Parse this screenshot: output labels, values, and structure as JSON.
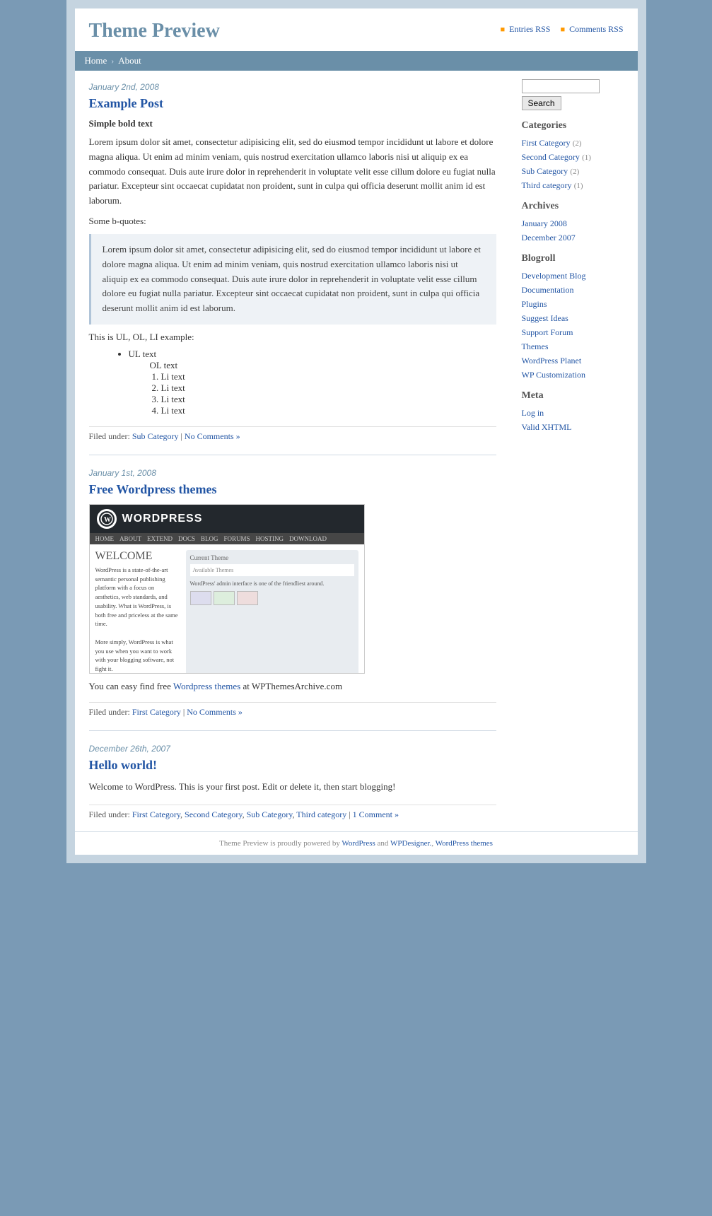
{
  "site": {
    "title": "Theme Preview",
    "rss_entries_label": "Entries RSS",
    "rss_comments_label": "Comments RSS"
  },
  "nav": {
    "home_label": "Home",
    "about_label": "About"
  },
  "posts": [
    {
      "date": "January 2nd, 2008",
      "title": "Example Post",
      "title_href": "#",
      "subtitle": "Simple bold text",
      "body1": "Lorem ipsum dolor sit amet, consectetur adipisicing elit, sed do eiusmod tempor incididunt ut labore et dolore magna aliqua. Ut enim ad minim veniam, quis nostrud exercitation ullamco laboris nisi ut aliquip ex ea commodo consequat. Duis aute irure dolor in reprehenderit in voluptate velit esse cillum dolore eu fugiat nulla pariatur. Excepteur sint occaecat cupidatat non proident, sunt in culpa qui officia deserunt mollit anim id est laborum.",
      "bquote_intro": "Some b-quotes:",
      "blockquote": "Lorem ipsum dolor sit amet, consectetur adipisicing elit, sed do eiusmod tempor incididunt ut labore et dolore magna aliqua. Ut enim ad minim veniam, quis nostrud exercitation ullamco laboris nisi ut aliquip ex ea commodo consequat. Duis aute irure dolor in reprehenderit in voluptate velit esse cillum dolore eu fugiat nulla pariatur. Excepteur sint occaecat cupidatat non proident, sunt in culpa qui officia deserunt mollit anim id est laborum.",
      "list_intro": "This is UL, OL, LI example:",
      "ul_label": "UL text",
      "ol_label": "OL text",
      "li_items": [
        "Li text",
        "Li text",
        "Li text",
        "Li text"
      ],
      "filed_under_label": "Filed under:",
      "filed_under_links": [
        {
          "text": "Sub Category",
          "href": "#"
        }
      ],
      "no_comments": "No Comments »",
      "no_comments_href": "#"
    },
    {
      "date": "January 1st, 2008",
      "title": "Free Wordpress themes",
      "title_href": "#",
      "free_text_before": "You can easy find free ",
      "free_text_link": "Wordpress themes",
      "free_text_link_href": "#",
      "free_text_after": " at WPThemesArchive.com",
      "filed_under_label": "Filed under:",
      "filed_under_links": [
        {
          "text": "First Category",
          "href": "#"
        }
      ],
      "no_comments": "No Comments »",
      "no_comments_href": "#"
    },
    {
      "date": "December 26th, 2007",
      "title": "Hello world!",
      "title_href": "#",
      "body": "Welcome to WordPress. This is your first post. Edit or delete it, then start blogging!",
      "filed_under_label": "Filed under:",
      "filed_under_links": [
        {
          "text": "First Category",
          "href": "#"
        },
        {
          "text": "Second Category",
          "href": "#"
        },
        {
          "text": "Sub Category",
          "href": "#"
        },
        {
          "text": "Third category",
          "href": "#"
        }
      ],
      "comments_link": "1 Comment »",
      "comments_href": "#"
    }
  ],
  "sidebar": {
    "search_placeholder": "",
    "search_button": "Search",
    "categories_title": "Categories",
    "categories": [
      {
        "label": "First Category",
        "count": "(2)",
        "href": "#"
      },
      {
        "label": "Second Category",
        "count": "(1)",
        "href": "#"
      },
      {
        "label": "Sub Category",
        "count": "(2)",
        "href": "#"
      },
      {
        "label": "Third category",
        "count": "(1)",
        "href": "#"
      }
    ],
    "archives_title": "Archives",
    "archives": [
      {
        "label": "January 2008",
        "href": "#"
      },
      {
        "label": "December 2007",
        "href": "#"
      }
    ],
    "blogroll_title": "Blogroll",
    "blogroll": [
      {
        "label": "Development Blog",
        "href": "#"
      },
      {
        "label": "Documentation",
        "href": "#"
      },
      {
        "label": "Plugins",
        "href": "#"
      },
      {
        "label": "Suggest Ideas",
        "href": "#"
      },
      {
        "label": "Support Forum",
        "href": "#"
      },
      {
        "label": "Themes",
        "href": "#"
      },
      {
        "label": "WordPress Planet",
        "href": "#"
      },
      {
        "label": "WP Customization",
        "href": "#"
      }
    ],
    "meta_title": "Meta",
    "meta": [
      {
        "label": "Log in",
        "href": "#"
      },
      {
        "label": "Valid XHTML",
        "href": "#"
      }
    ]
  },
  "footer": {
    "text1": "Theme Preview is proudly powered by ",
    "wp_link": "WordPress",
    "text2": " and ",
    "wpd_link": "WPDesigner.",
    "text3": ", ",
    "themes_link": "WordPress themes"
  },
  "wordpress_screenshot": {
    "logo_text": "W",
    "site_name": "WORDPRESS",
    "nav_items": [
      "HOME",
      "ABOUT",
      "EXTEND",
      "DOCS",
      "BLOG",
      "FORUMS",
      "HOSTING",
      "DOWNLOAD"
    ],
    "welcome_title": "WELCOME",
    "body_text": "WordPress is a state-of-the-art semantic personal publishing platform with a focus on aesthetics, web standards, and usability. What is WordPress, is both free and priceless at the same time.\n\nMore simply, WordPress is what you use when you want to work with your blogging software, not fight it.\n\nTo get started with WordPress, set it up on a web host for the most flexibility or get a free blog on WordPress.com."
  }
}
